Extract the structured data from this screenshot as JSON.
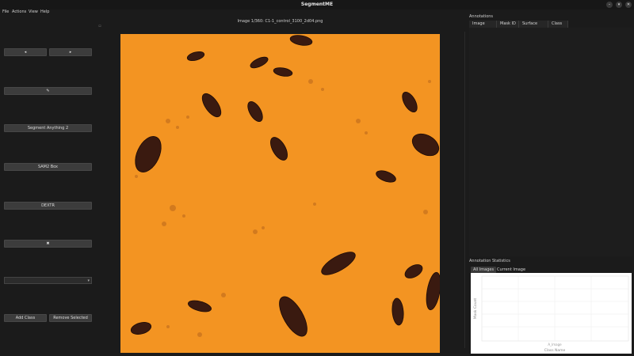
{
  "window": {
    "title": "SegmentME",
    "controls": [
      "–",
      "▾",
      "✕"
    ]
  },
  "menu": [
    "File",
    "Actions",
    "View",
    "Help"
  ],
  "toolbar": {
    "left_arrow": "◂",
    "right_arrow": "▸",
    "pencil": "✎",
    "sam2": "Segment Anything 2",
    "sam_box": "SAM2 Box",
    "dextr": "DEXTR",
    "close_glyph": "✖",
    "combo_value": "",
    "combo_arrow": "▾",
    "add_class": "Add Class",
    "remove_selected": "Remove Selected"
  },
  "image": {
    "caption": "Image 1/360: C1-1_control_3100_2d04.png",
    "background": "#f39422"
  },
  "annotations": {
    "title": "Annotations",
    "columns": [
      "Image Name",
      "Mask ID",
      "Surface Area",
      "Class"
    ]
  },
  "stats": {
    "title": "Annotation Statistics",
    "tabs": [
      "All Images",
      "Current Image"
    ],
    "xlabel": "Class Name",
    "ylabel": "Mask Count",
    "tick": "A_Image"
  },
  "colors": {
    "accent": "#f39422",
    "cell": "#3a1a10"
  }
}
